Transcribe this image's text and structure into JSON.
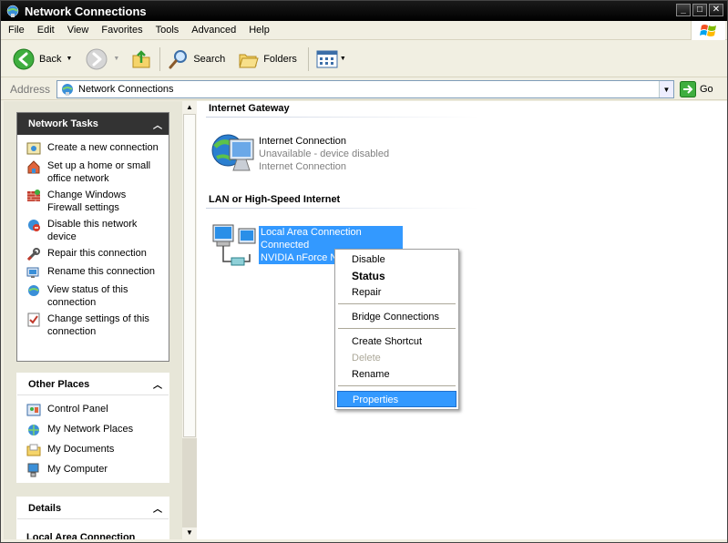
{
  "window": {
    "title": "Network Connections",
    "buttons": [
      "_",
      "□",
      "✕"
    ]
  },
  "menubar": {
    "items": [
      "File",
      "Edit",
      "View",
      "Favorites",
      "Tools",
      "Advanced",
      "Help"
    ]
  },
  "toolbar": {
    "back_label": "Back",
    "search_label": "Search",
    "folders_label": "Folders"
  },
  "address": {
    "label": "Address",
    "value": "Network Connections",
    "go_label": "Go"
  },
  "network_tasks": {
    "title": "Network Tasks",
    "items": [
      {
        "label": "Create a new connection",
        "icon": "new-connection-icon"
      },
      {
        "label": "Set up a home or small office network",
        "icon": "home-network-icon"
      },
      {
        "label": "Change Windows Firewall settings",
        "icon": "firewall-icon"
      },
      {
        "label": "Disable this network device",
        "icon": "disable-device-icon"
      },
      {
        "label": "Repair this connection",
        "icon": "repair-icon"
      },
      {
        "label": "Rename this connection",
        "icon": "rename-icon"
      },
      {
        "label": "View status of this connection",
        "icon": "status-icon"
      },
      {
        "label": "Change settings of this connection",
        "icon": "settings-icon"
      }
    ]
  },
  "other_places": {
    "title": "Other Places",
    "items": [
      {
        "label": "Control Panel",
        "icon": "control-panel-icon"
      },
      {
        "label": "My Network Places",
        "icon": "network-places-icon"
      },
      {
        "label": "My Documents",
        "icon": "documents-icon"
      },
      {
        "label": "My Computer",
        "icon": "computer-icon"
      }
    ]
  },
  "details": {
    "title": "Details",
    "partial_text": "Local Area Connection"
  },
  "groups": [
    {
      "title": "Internet Gateway",
      "connection": {
        "name": "Internet Connection",
        "status": "Unavailable - device disabled",
        "device": "Internet Connection"
      }
    },
    {
      "title": "LAN or High-Speed Internet",
      "connection": {
        "name": "Local Area Connection",
        "status": "Connected",
        "device": "NVIDIA nForce N"
      }
    }
  ],
  "context_menu": {
    "items": [
      "Disable",
      "Status",
      "Repair",
      "Bridge Connections",
      "Create Shortcut",
      "Delete",
      "Rename",
      "Properties"
    ]
  },
  "colors": {
    "selection": "#3399ff",
    "titlebar": "#000000",
    "panel_header_dark": "#333333"
  }
}
